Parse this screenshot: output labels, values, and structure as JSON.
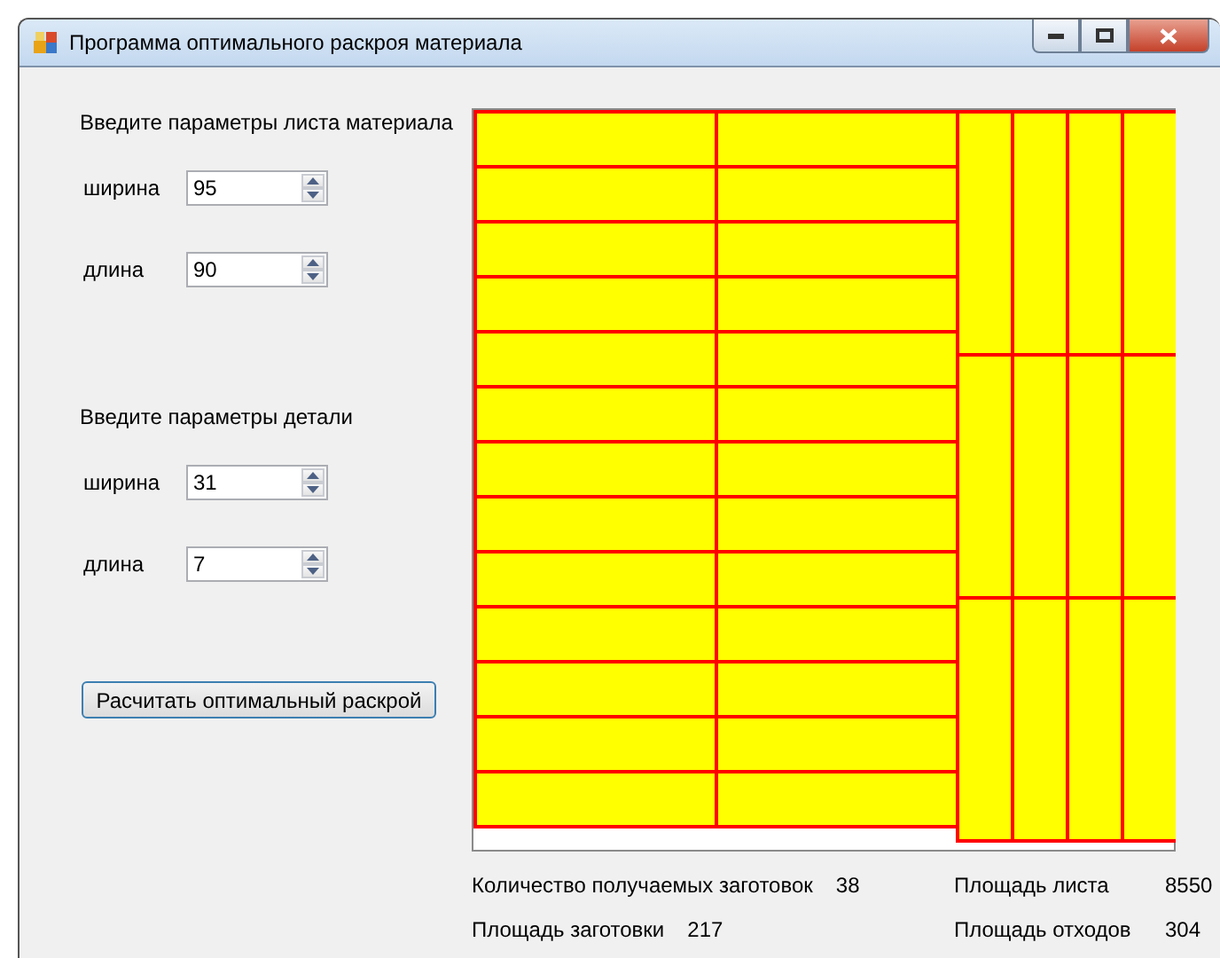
{
  "window": {
    "title": "Программа оптимального раскроя материала"
  },
  "sections": [
    {
      "heading": "Введите параметры листа материала",
      "fields": [
        {
          "label": "ширина",
          "value": "95"
        },
        {
          "label": "длина",
          "value": "90"
        }
      ]
    },
    {
      "heading": "Введите параметры детали",
      "fields": [
        {
          "label": "ширина",
          "value": "31"
        },
        {
          "label": "длина",
          "value": "7"
        }
      ]
    }
  ],
  "calculate_button": "Расчитать оптимальный раскрой",
  "results": [
    {
      "label": "Количество получаемых заготовок",
      "value": "38"
    },
    {
      "label": "Площадь листа",
      "value": "8550"
    },
    {
      "label": "Площадь заготовки",
      "value": "217"
    },
    {
      "label": "Площадь отходов",
      "value": "304"
    }
  ]
}
